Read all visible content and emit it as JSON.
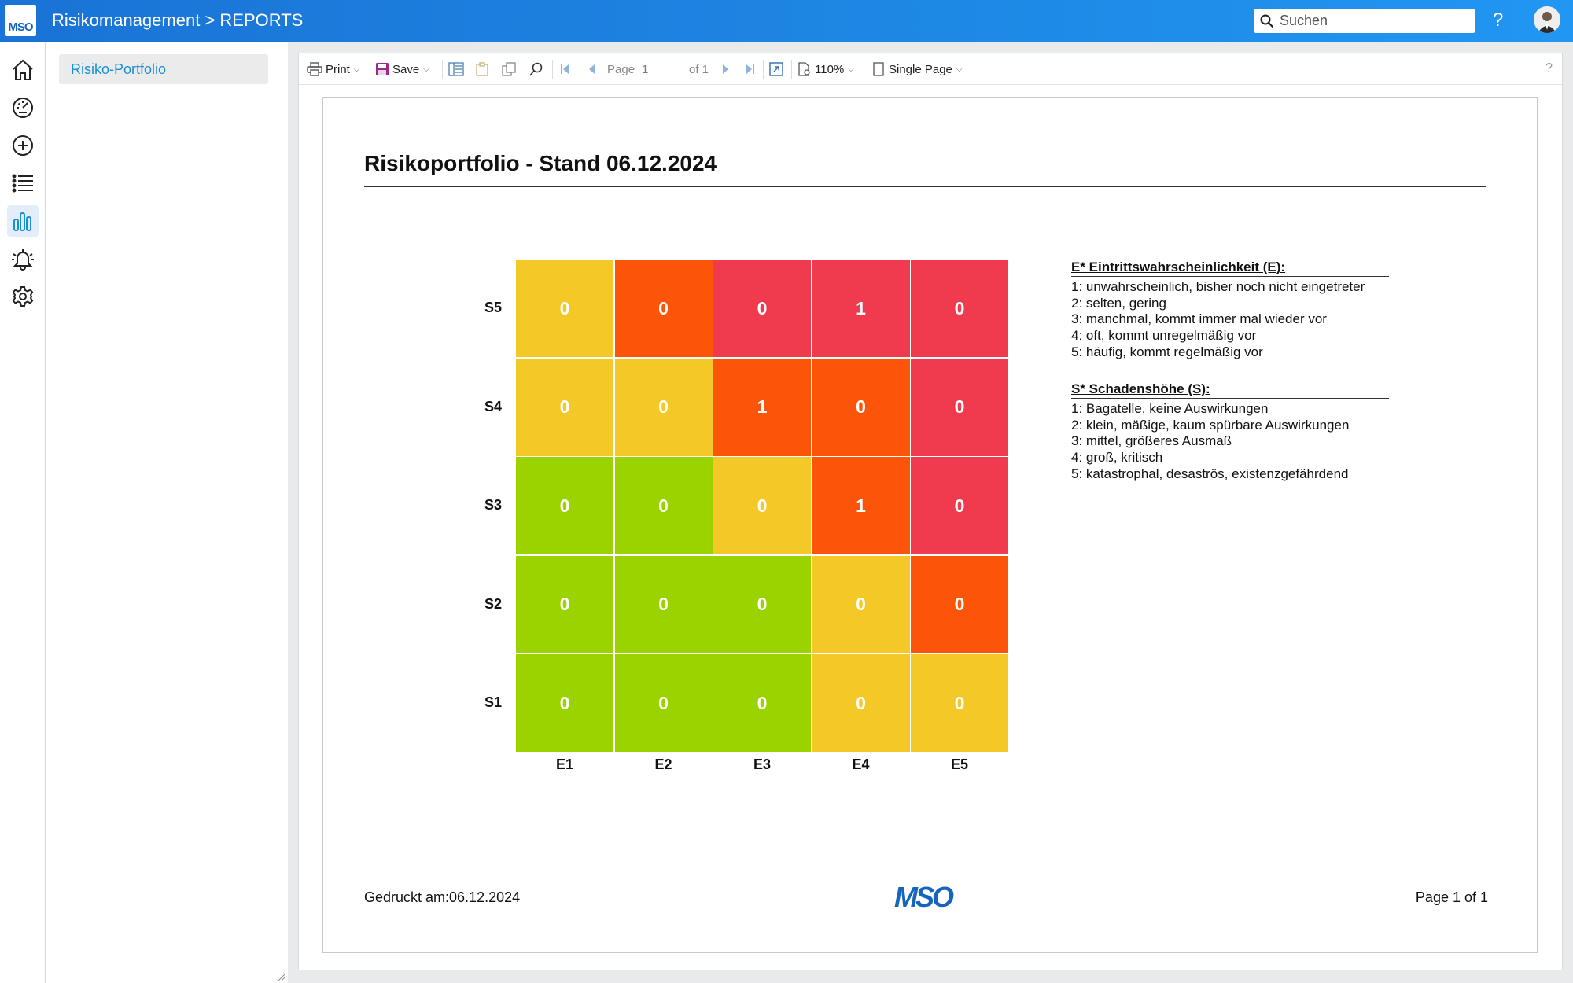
{
  "header": {
    "logo_text": "MSO",
    "title": "Risikomanagement > REPORTS",
    "search_placeholder": "Suchen",
    "help": "?"
  },
  "rail": {
    "items": [
      "home-icon",
      "dashboard-gauge-icon",
      "add-circle-icon",
      "list-icon",
      "bar-chart-icon",
      "alarm-bell-icon",
      "settings-gear-icon"
    ],
    "active": "bar-chart-icon"
  },
  "subnav": {
    "items": [
      {
        "label": "Risiko-Portfolio"
      }
    ]
  },
  "toolbar": {
    "print": "Print",
    "save": "Save",
    "page_label": "Page",
    "page_value": "1",
    "of_label": "of 1",
    "zoom": "110%",
    "view_mode": "Single Page",
    "help": "?"
  },
  "report": {
    "title": "Risikoportfolio - Stand 06.12.2024",
    "printed": "Gedruckt am:06.12.2024",
    "logo_text": "MSO",
    "page_footer": "Page 1 of 1",
    "legend_e": {
      "heading": "E* Eintrittswahrscheinlichkeit (E):",
      "lines": [
        "1: unwahrscheinlich, bisher noch nicht eingetreter",
        "2: selten, gering",
        "3: manchmal, kommt immer mal wieder vor",
        "4: oft, kommt unregelmäßig vor",
        "5: häufig, kommt regelmäßig vor"
      ]
    },
    "legend_s": {
      "heading": "S* Schadenshöhe (S):",
      "lines": [
        "1: Bagatelle, keine Auswirkungen",
        "2: klein, mäßige, kaum spürbare Auswirkungen",
        "3: mittel, größeres Ausmaß",
        "4: groß, kritisch",
        "5: katastrophal, desaströs, existenzgefährdend"
      ]
    }
  },
  "chart_data": {
    "type": "heatmap",
    "title": "Risikoportfolio - Stand 06.12.2024",
    "x_labels": [
      "E1",
      "E2",
      "E3",
      "E4",
      "E5"
    ],
    "y_labels": [
      "S5",
      "S4",
      "S3",
      "S2",
      "S1"
    ],
    "values": [
      [
        0,
        0,
        0,
        1,
        0
      ],
      [
        0,
        0,
        1,
        0,
        0
      ],
      [
        0,
        0,
        0,
        1,
        0
      ],
      [
        0,
        0,
        0,
        0,
        0
      ],
      [
        0,
        0,
        0,
        0,
        0
      ]
    ],
    "cell_levels": [
      [
        "yellow",
        "orange",
        "red",
        "red",
        "red"
      ],
      [
        "yellow",
        "yellow",
        "orange",
        "orange",
        "red"
      ],
      [
        "green",
        "green",
        "yellow",
        "orange",
        "red"
      ],
      [
        "green",
        "green",
        "green",
        "yellow",
        "orange"
      ],
      [
        "green",
        "green",
        "green",
        "yellow",
        "yellow"
      ]
    ],
    "colors": {
      "green": "#9ad300",
      "yellow": "#f4c826",
      "orange": "#fc5409",
      "red": "#ef3b4d"
    }
  }
}
